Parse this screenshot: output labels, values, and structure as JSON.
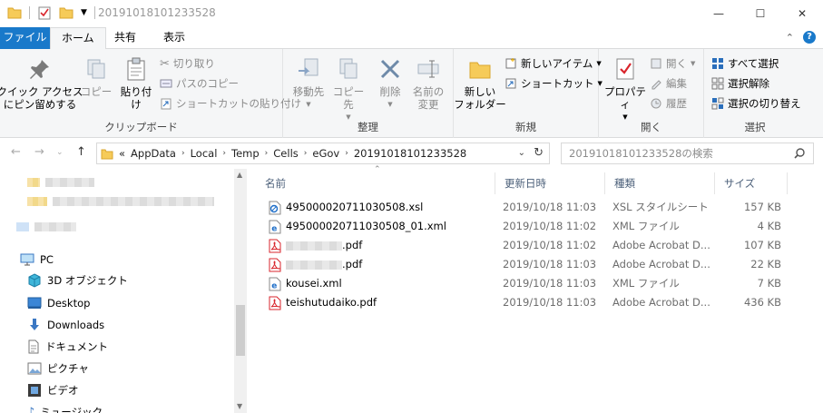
{
  "window": {
    "title": "20191018101233528",
    "buttons": [
      "—",
      "☐",
      "✕"
    ]
  },
  "tabs": {
    "file": "ファイル",
    "home": "ホーム",
    "share": "共有",
    "view": "表示"
  },
  "ribbon": {
    "clipboard": {
      "label": "クリップボード",
      "pin": "クイック アクセス\nにピン留めする",
      "copy": "コピー",
      "paste": "貼り付け",
      "cut": "切り取り",
      "copy_path": "パスのコピー",
      "paste_shortcut": "ショートカットの貼り付け"
    },
    "organize": {
      "label": "整理",
      "move_to": "移動先",
      "copy_to": "コピー先",
      "delete": "削除",
      "rename": "名前の\n変更"
    },
    "new": {
      "label": "新規",
      "new_folder": "新しい\nフォルダー",
      "new_item": "新しいアイテム",
      "shortcut": "ショートカット"
    },
    "open": {
      "label": "開く",
      "properties": "プロパティ",
      "open": "開く",
      "edit": "編集",
      "history": "履歴"
    },
    "select": {
      "label": "選択",
      "select_all": "すべて選択",
      "select_none": "選択解除",
      "invert": "選択の切り替え"
    }
  },
  "address": {
    "crumbs": [
      "AppData",
      "Local",
      "Temp",
      "Cells",
      "eGov",
      "20191018101233528"
    ],
    "overflow": "«",
    "search_placeholder": "20191018101233528の検索"
  },
  "navpane": {
    "pc": "PC",
    "items": [
      "3D オブジェクト",
      "Desktop",
      "Downloads",
      "ドキュメント",
      "ピクチャ",
      "ビデオ",
      "ミュージック"
    ]
  },
  "columns": [
    "名前",
    "更新日時",
    "種類",
    "サイズ"
  ],
  "files": [
    {
      "name": "495000020711030508.xsl",
      "date": "2019/10/18 11:03",
      "type": "XSL スタイルシート",
      "size": "157 KB",
      "icon": "xsl-icon"
    },
    {
      "name": "495000020711030508_01.xml",
      "date": "2019/10/18 11:02",
      "type": "XML ファイル",
      "size": "4 KB",
      "icon": "xml-icon"
    },
    {
      "name": ".pdf",
      "date": "2019/10/18 11:02",
      "type": "Adobe Acrobat D...",
      "size": "107 KB",
      "icon": "pdf-icon",
      "redacted": true
    },
    {
      "name": ".pdf",
      "date": "2019/10/18 11:03",
      "type": "Adobe Acrobat D...",
      "size": "22 KB",
      "icon": "pdf-icon",
      "redacted": true
    },
    {
      "name": "kousei.xml",
      "date": "2019/10/18 11:03",
      "type": "XML ファイル",
      "size": "7 KB",
      "icon": "xml-icon"
    },
    {
      "name": "teishutudaiko.pdf",
      "date": "2019/10/18 11:03",
      "type": "Adobe Acrobat D...",
      "size": "436 KB",
      "icon": "pdf-icon"
    }
  ],
  "colors": {
    "file_tab": "#1979ca",
    "ribbon_bg": "#f5f6f7",
    "header_text": "#4c607a",
    "pdf_red": "#d9252c",
    "xml_blue": "#1e6ec8",
    "folder_yellow": "#f6cb59"
  }
}
